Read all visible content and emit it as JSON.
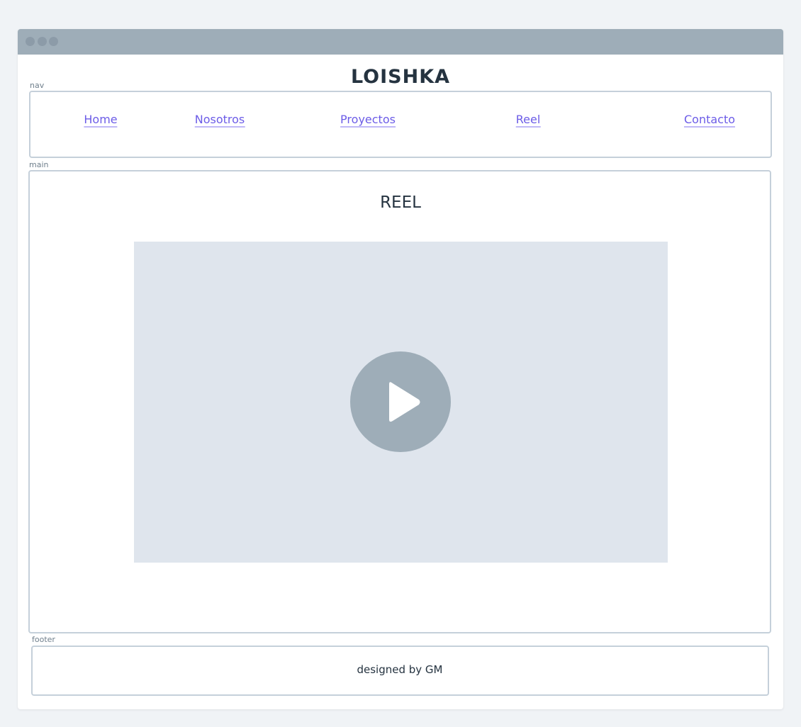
{
  "header": {
    "title": "LOISHKA"
  },
  "labels": {
    "nav": "nav",
    "main": "main",
    "footer": "footer"
  },
  "nav": {
    "items": [
      {
        "label": "Home"
      },
      {
        "label": "Nosotros"
      },
      {
        "label": "Proyectos"
      },
      {
        "label": "Reel"
      },
      {
        "label": "Contacto"
      }
    ]
  },
  "main": {
    "heading": "REEL",
    "video_icon": "play-icon"
  },
  "footer": {
    "text": "designed by GM"
  },
  "colors": {
    "link": "#6c5ce7",
    "text": "#253340",
    "border": "#c5d0da",
    "placeholder": "#dfe5ed"
  }
}
